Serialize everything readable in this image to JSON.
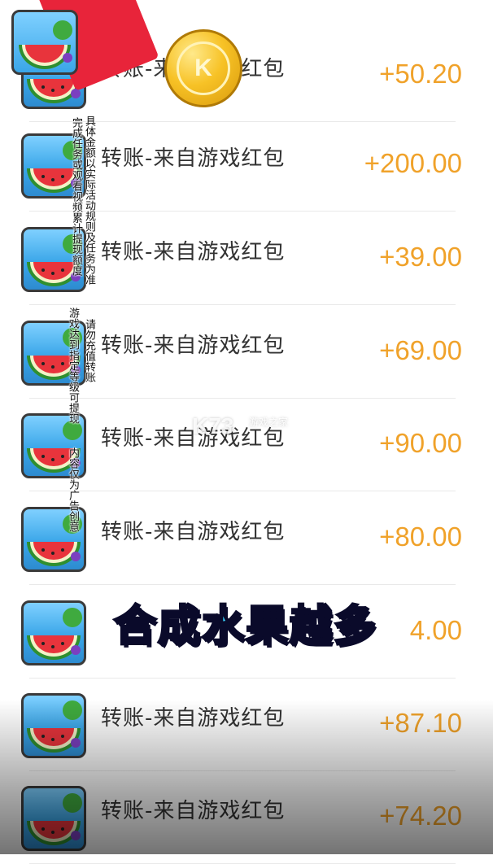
{
  "transactions": [
    {
      "title": "转账-来自游戏红包",
      "amount": "+50.20"
    },
    {
      "title": "转账-来自游戏红包",
      "amount": "+200.00"
    },
    {
      "title": "转账-来自游戏红包",
      "amount": "+39.00"
    },
    {
      "title": "转账-来自游戏红包",
      "amount": "+69.00"
    },
    {
      "title": "转账-来自游戏红包",
      "amount": "+90.00"
    },
    {
      "title": "转账-来自游戏红包",
      "amount": "+80.00"
    },
    {
      "title": "",
      "amount": "4.00"
    },
    {
      "title": "转账-来自游戏红包",
      "amount": "+87.10"
    },
    {
      "title": "转账-来自游戏红包",
      "amount": "+74.20"
    }
  ],
  "disclaimer": {
    "col1": "具体金额以实际活动规则及任务为准",
    "col2": "完成任务或观看视频累计提现额度",
    "col3": "请勿充值转账",
    "col4": "游戏达到指定等级可提现",
    "col5": "内容仅为广告创意"
  },
  "banner_text": "合成水果越多",
  "watermark": {
    "logo": "K73",
    "sub": "游戏之家"
  },
  "coin_text": "K",
  "colors": {
    "amount": "#f0a22a",
    "banner": "#3ad6ff",
    "redpacket": "#e8243a"
  }
}
